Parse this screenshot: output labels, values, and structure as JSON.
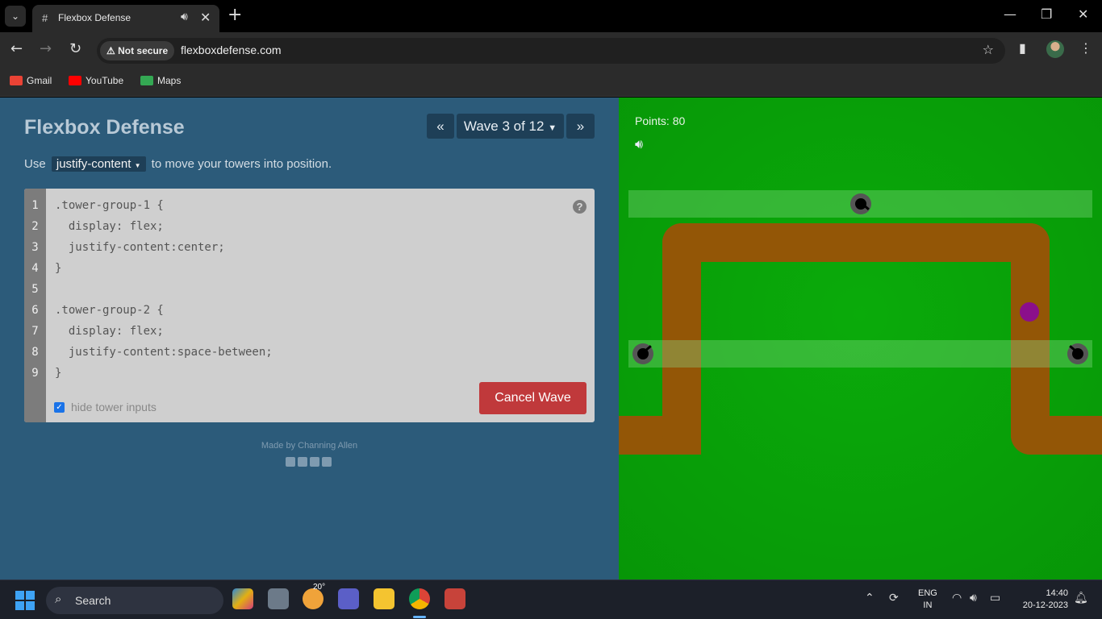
{
  "browser": {
    "tab": {
      "title": "Flexbox Defense",
      "favicon": "hash-icon"
    },
    "omnibox": {
      "security": "Not secure",
      "url": "flexboxdefense.com"
    },
    "bookmarks": [
      {
        "label": "Gmail",
        "color": "#ea4335"
      },
      {
        "label": "YouTube",
        "color": "#ff0000"
      },
      {
        "label": "Maps",
        "color": "#34a853"
      }
    ]
  },
  "game_panel": {
    "title": "Flexbox Defense",
    "wave_label": "Wave 3 of 12",
    "prev_symbol": "«",
    "next_symbol": "»",
    "instruction_before": "Use",
    "property": "justify-content",
    "instruction_after": "to move your towers into position.",
    "code_lines": [
      ".tower-group-1 {",
      "  display: flex;",
      "  justify-content:center;",
      "}",
      "",
      ".tower-group-2 {",
      "  display: flex;",
      "  justify-content:space-between;",
      "}"
    ],
    "line_numbers": [
      "1",
      "2",
      "3",
      "4",
      "5",
      "6",
      "7",
      "8",
      "9"
    ],
    "help_symbol": "?",
    "hide_inputs_label": "hide tower inputs",
    "hide_inputs_checked": true,
    "cancel_label": "Cancel Wave",
    "footer": "Made by Channing Allen"
  },
  "board": {
    "points_text": "Points: 80",
    "colors": {
      "grass": "#0aa30a",
      "path": "#935606",
      "enemy": "#8b0f8b",
      "tower": "#555555"
    }
  },
  "taskbar": {
    "search_label": "Search",
    "weather_temp": "20°",
    "language": "ENG",
    "region": "IN",
    "time": "14:40",
    "date": "20-12-2023"
  }
}
